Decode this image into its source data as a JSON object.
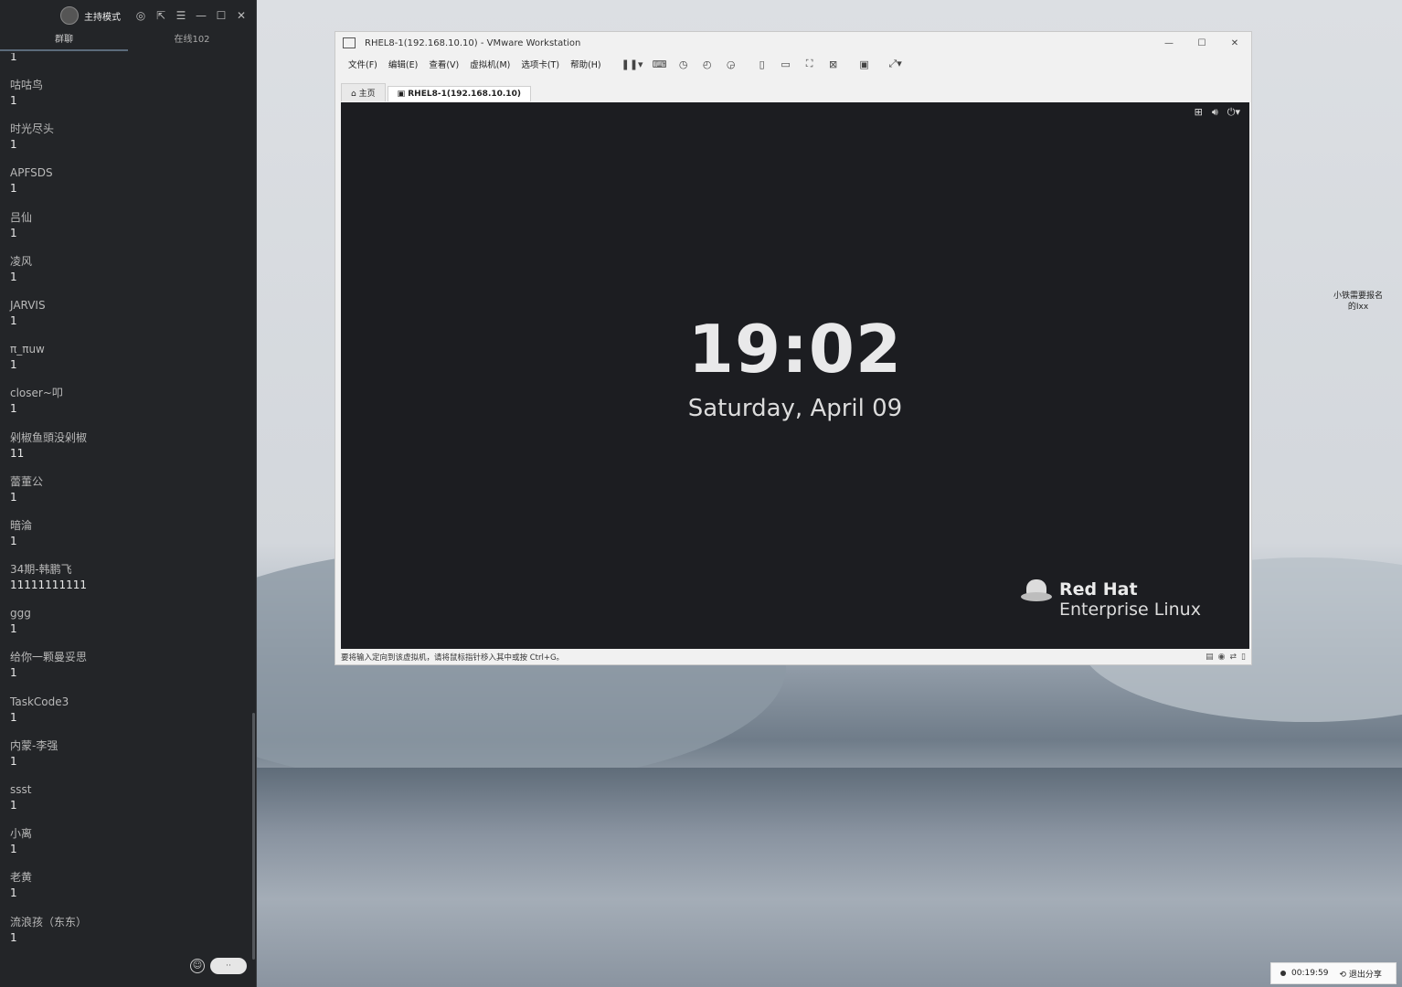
{
  "sidebar": {
    "mode_label": "主持模式",
    "tabs": [
      {
        "label": "群聊"
      },
      {
        "label": "在线102"
      }
    ],
    "top_partial": "1",
    "messages": [
      {
        "name": "咕咕鸟",
        "text": "1"
      },
      {
        "name": "时光尽头",
        "text": "1"
      },
      {
        "name": "APFSDS",
        "text": "1"
      },
      {
        "name": "吕仙",
        "text": "1"
      },
      {
        "name": "凌风",
        "text": "1"
      },
      {
        "name": "JARVIS",
        "text": "1"
      },
      {
        "name": "π_πuw",
        "text": "1"
      },
      {
        "name": "closer~叩",
        "text": "1"
      },
      {
        "name": "剁椒鱼頭没剁椒",
        "text": "11"
      },
      {
        "name": "蕾董公",
        "text": "1"
      },
      {
        "name": "暗淪",
        "text": "1"
      },
      {
        "name": "34期-韩鹏飞",
        "text": "11111111111"
      },
      {
        "name": "ggg",
        "text": "1"
      },
      {
        "name": "给你一颗曼妥思",
        "text": "1"
      },
      {
        "name": "TaskCode3",
        "text": "1"
      },
      {
        "name": "内蒙-李强",
        "text": "1"
      },
      {
        "name": "ssst",
        "text": "1"
      },
      {
        "name": "小离",
        "text": "1"
      },
      {
        "name": "老黄",
        "text": "1"
      },
      {
        "name": "流浪孩（东东）",
        "text": "1"
      }
    ]
  },
  "vmware": {
    "title": "RHEL8-1(192.168.10.10) - VMware Workstation",
    "menu": [
      "文件(F)",
      "编辑(E)",
      "查看(V)",
      "虚拟机(M)",
      "选项卡(T)",
      "帮助(H)"
    ],
    "tabs": [
      {
        "label": "主页"
      },
      {
        "label": "RHEL8-1(192.168.10.10)"
      }
    ],
    "status_message": "要将输入定向到该虚拟机，请将鼠标指针移入其中或按 Ctrl+G。"
  },
  "lockscreen": {
    "time": "19:02",
    "date": "Saturday, April 09",
    "brand_line1": "Red Hat",
    "brand_line2": "Enterprise Linux"
  },
  "desktop": {
    "icon_label": "小铁需要报名的Ixx"
  },
  "sharebar": {
    "elapsed": "00:19:59",
    "exit_label": "退出分享"
  },
  "colors": {
    "sidebar_bg": "#232528",
    "vm_screen_bg": "#1c1d21",
    "window_bg": "#f1f1f1"
  }
}
